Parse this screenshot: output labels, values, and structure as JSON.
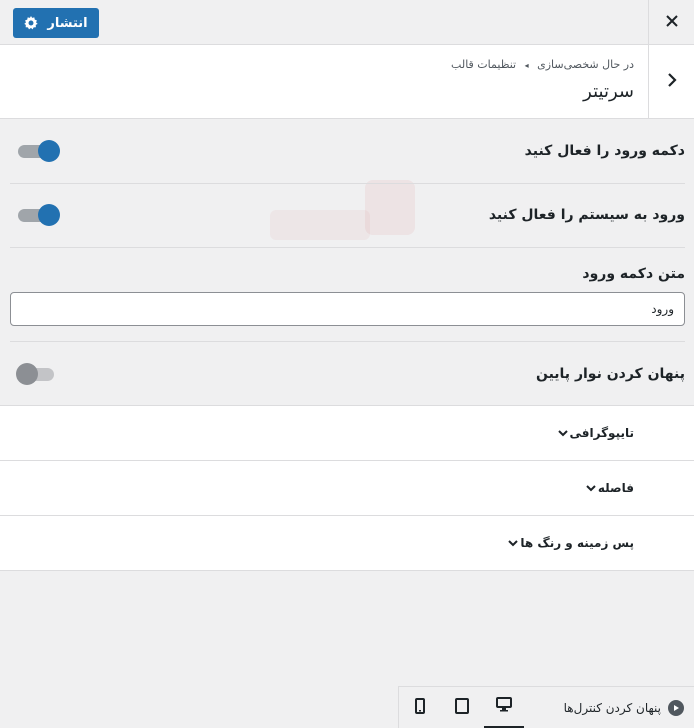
{
  "topbar": {
    "publish_label": "انتشار",
    "publish_icon": "gear-icon",
    "close_icon": "close-icon"
  },
  "header": {
    "breadcrumb_customizing": "در حال شخصی‌سازی",
    "breadcrumb_separator": "◂",
    "breadcrumb_parent": "تنظیمات قالب",
    "title": "سرتیتر",
    "back_icon": "chevron-right-icon"
  },
  "settings": {
    "login_button_toggle_label": "دکمه ورود را فعال کنید",
    "login_button_toggle_state": "on",
    "system_login_toggle_label": "ورود به سیستم را فعال کنید",
    "system_login_toggle_state": "on",
    "login_text_label": "متن دکمه ورود",
    "login_text_value": "ورود",
    "hide_bottom_bar_label": "پنهان کردن نوار پایین",
    "hide_bottom_bar_state": "off"
  },
  "accordions": [
    {
      "label": "تایپوگرافی"
    },
    {
      "label": "فاصله"
    },
    {
      "label": "پس زمینه و رنگ ها"
    }
  ],
  "footer": {
    "hide_controls_label": "پنهان کردن کنترل‌ها",
    "devices": [
      "desktop-icon",
      "tablet-icon",
      "mobile-icon"
    ],
    "active_device": "desktop"
  },
  "colors": {
    "accent": "#2271b1",
    "background": "#f0f0f1",
    "panel": "#ffffff",
    "border": "#dcdcde"
  }
}
